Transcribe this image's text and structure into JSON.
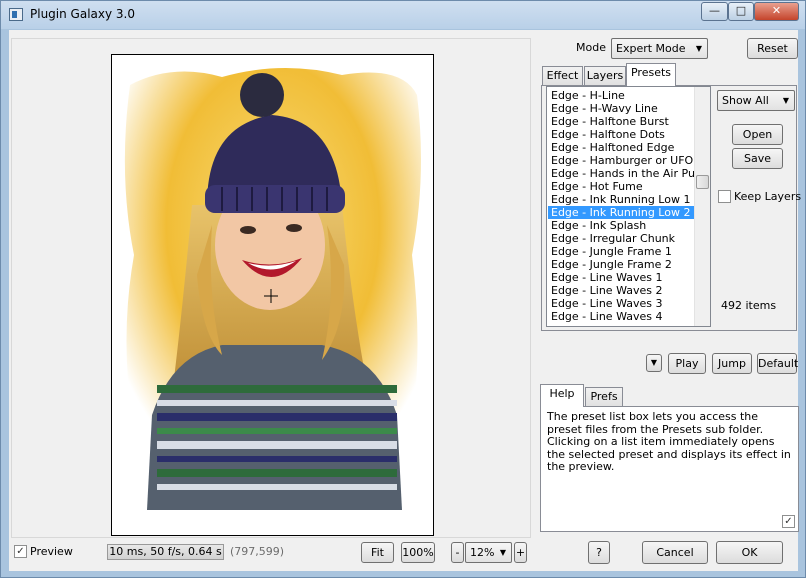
{
  "window": {
    "title": "Plugin Galaxy 3.0",
    "minimize": "—",
    "maximize": "□",
    "close": "✕"
  },
  "mode": {
    "label": "Mode",
    "value": "Expert Mode",
    "reset": "Reset"
  },
  "tabs": {
    "effect": "Effect",
    "layers": "Layers",
    "presets": "Presets"
  },
  "presets": {
    "items": [
      "Edge - H-Line",
      "Edge - H-Wavy Line",
      "Edge - Halftone Burst",
      "Edge - Halftone Dots",
      "Edge - Halftoned Edge",
      "Edge - Hamburger or UFO",
      "Edge - Hands in the Air Puppet",
      "Edge - Hot Fume",
      "Edge - Ink Running Low 1",
      "Edge - Ink Running Low 2",
      "Edge - Ink Splash",
      "Edge - Irregular Chunk",
      "Edge - Jungle Frame 1",
      "Edge - Jungle Frame 2",
      "Edge - Line Waves 1",
      "Edge - Line Waves 2",
      "Edge - Line Waves 3",
      "Edge - Line Waves 4"
    ],
    "selected_index": 9,
    "filter": "Show All",
    "open": "Open",
    "save": "Save",
    "keep_layers": "Keep Layers",
    "keep_layers_checked": false,
    "count": "492 items"
  },
  "playback": {
    "menu_arrow": "▼",
    "play": "Play",
    "jump": "Jump",
    "default": "Default"
  },
  "help_tabs": {
    "help": "Help",
    "prefs": "Prefs"
  },
  "help": {
    "text": "The preset list box lets you access the preset files from the Presets sub folder. Clicking on a list item immediately opens the selected preset and displays its effect in the preview.",
    "checked": true
  },
  "bottom": {
    "preview_label": "Preview",
    "preview_checked": true,
    "timing": "10 ms, 50 f/s, 0.64 s",
    "coords": "(797,599)",
    "fit": "Fit",
    "zoom_100": "100%",
    "zoom_minus": "-",
    "zoom_value": "12%",
    "zoom_plus": "+",
    "help_button": "?",
    "cancel": "Cancel",
    "ok": "OK"
  },
  "colors": {
    "selection": "#3399ff",
    "frame": "#a9c4de",
    "hat": "#2f2b5a",
    "hair": "#d9a441",
    "background_glow": "#f3c23a"
  }
}
